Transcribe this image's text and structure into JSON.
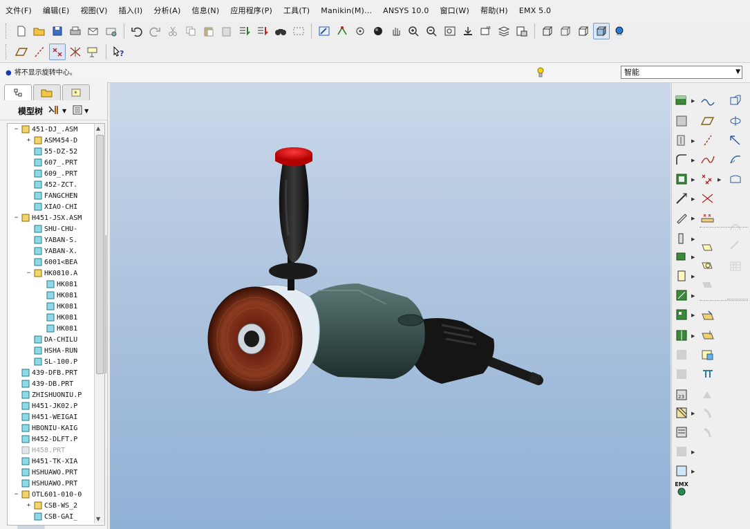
{
  "menubar": {
    "items": [
      "文件(F)",
      "编辑(E)",
      "视图(V)",
      "插入(I)",
      "分析(A)",
      "信息(N)",
      "应用程序(P)",
      "工具(T)",
      "Manikin(M)...",
      "ANSYS 10.0",
      "窗口(W)",
      "帮助(H)",
      "EMX 5.0"
    ]
  },
  "status": {
    "message": "将不显示旋转中心。",
    "filter_value": "智能"
  },
  "model_tree": {
    "title": "模型树",
    "items": [
      {
        "label": "451-DJ_.ASM",
        "level": 1,
        "type": "asm",
        "toggle": "−"
      },
      {
        "label": "ASM454-D",
        "level": 2,
        "type": "asm",
        "toggle": "+"
      },
      {
        "label": "55-DZ-52",
        "level": 2,
        "type": "prt"
      },
      {
        "label": "607_.PRT",
        "level": 2,
        "type": "prt"
      },
      {
        "label": "609_.PRT",
        "level": 2,
        "type": "prt"
      },
      {
        "label": "452-ZCT.",
        "level": 2,
        "type": "prt"
      },
      {
        "label": "FANGCHEN",
        "level": 2,
        "type": "prt"
      },
      {
        "label": "XIAO-CHI",
        "level": 2,
        "type": "prt"
      },
      {
        "label": "H451-JSX.ASM",
        "level": 1,
        "type": "asm",
        "toggle": "−"
      },
      {
        "label": "SHU-CHU-",
        "level": 2,
        "type": "prt"
      },
      {
        "label": "YABAN-S.",
        "level": 2,
        "type": "prt"
      },
      {
        "label": "YABAN-X.",
        "level": 2,
        "type": "prt"
      },
      {
        "label": "6001<BEA",
        "level": 2,
        "type": "prt"
      },
      {
        "label": "HK0810.A",
        "level": 2,
        "type": "asm",
        "toggle": "−"
      },
      {
        "label": "HK081",
        "level": 3,
        "type": "prt"
      },
      {
        "label": "HK081",
        "level": 3,
        "type": "prt"
      },
      {
        "label": "HK081",
        "level": 3,
        "type": "prt"
      },
      {
        "label": "HK081",
        "level": 3,
        "type": "prt"
      },
      {
        "label": "HK081",
        "level": 3,
        "type": "prt"
      },
      {
        "label": "DA-CHILU",
        "level": 2,
        "type": "prt"
      },
      {
        "label": "HSHA-RUN",
        "level": 2,
        "type": "prt"
      },
      {
        "label": "SL-100.P",
        "level": 2,
        "type": "prt"
      },
      {
        "label": "439-DFB.PRT",
        "level": 1,
        "type": "prt"
      },
      {
        "label": "439-DB.PRT",
        "level": 1,
        "type": "prt"
      },
      {
        "label": "ZHISHUONIU.P",
        "level": 1,
        "type": "prt"
      },
      {
        "label": "H451-JK02.P",
        "level": 1,
        "type": "prt"
      },
      {
        "label": "H451-WEIGAI",
        "level": 1,
        "type": "prt"
      },
      {
        "label": "HBONIU-KAIG",
        "level": 1,
        "type": "prt"
      },
      {
        "label": "H452-DLFT.P",
        "level": 1,
        "type": "prt"
      },
      {
        "label": "H458.PRT",
        "level": 1,
        "type": "prt",
        "dim": true
      },
      {
        "label": "H451-TK-XIA",
        "level": 1,
        "type": "prt"
      },
      {
        "label": "HSHUAWO.PRT",
        "level": 1,
        "type": "prt"
      },
      {
        "label": "HSHUAWO.PRT",
        "level": 1,
        "type": "prt"
      },
      {
        "label": "OTL601-010-0",
        "level": 1,
        "type": "asm",
        "toggle": "−"
      },
      {
        "label": "CSB-WS_2",
        "level": 2,
        "type": "asm",
        "toggle": "+"
      },
      {
        "label": "CSB-GAI_",
        "level": 2,
        "type": "prt"
      }
    ]
  },
  "right_toolbar": {
    "emx_label": "EMX"
  },
  "colors": {
    "accent": "#1a3ab0",
    "viewport_top": "#cbd8ea",
    "viewport_bottom": "#8fb1d6"
  }
}
